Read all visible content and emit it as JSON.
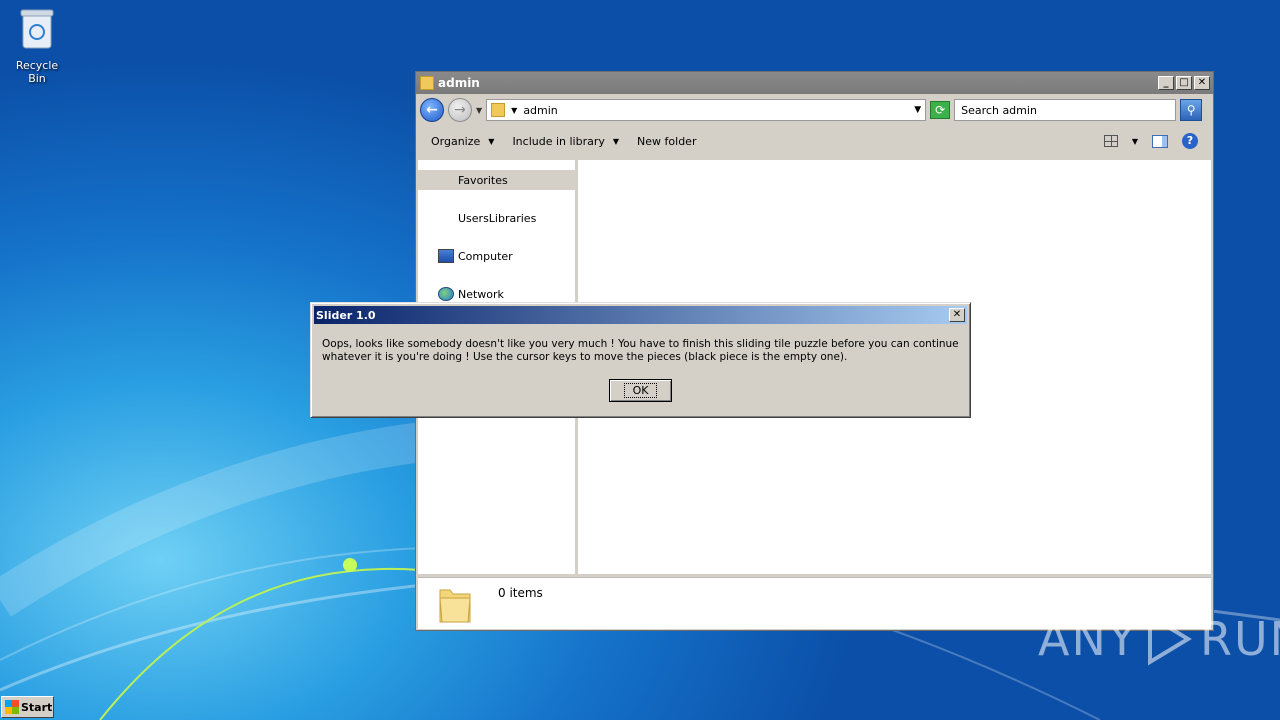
{
  "desktop": {
    "recycle_bin_label": "Recycle Bin"
  },
  "explorer": {
    "title": "admin",
    "address": "admin",
    "search_placeholder": "Search admin",
    "toolbar": {
      "organize": "Organize",
      "include_in_library": "Include in library",
      "new_folder": "New folder"
    },
    "nav": {
      "favorites": "Favorites",
      "libraries": "UsersLibraries",
      "computer": "Computer",
      "network": "Network"
    },
    "status": {
      "item_count": "0 items"
    }
  },
  "dialog": {
    "title": "Slider 1.0",
    "message": "Oops, looks like somebody doesn't like you very much ! You have to finish this sliding tile puzzle before you can continue whatever it is you're doing ! Use the cursor keys to move the pieces (black piece is the empty one).",
    "ok_label": "OK"
  },
  "taskbar": {
    "start_label": "Start"
  },
  "watermark": {
    "left": "ANY",
    "right": "RUN"
  }
}
